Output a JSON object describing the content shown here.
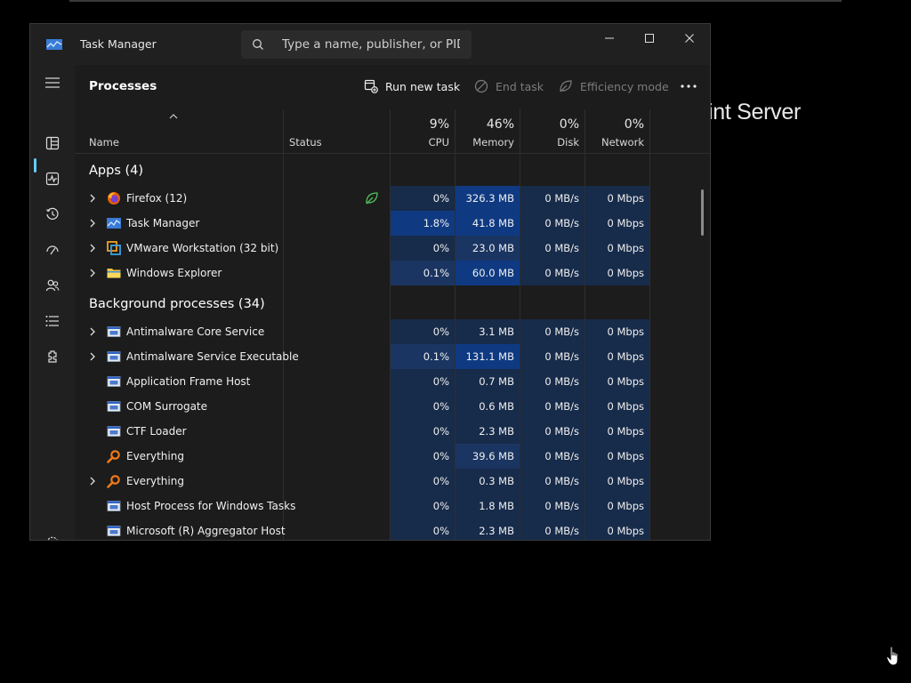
{
  "background": {
    "partial_text": "int Server"
  },
  "window": {
    "title": "Task Manager",
    "search_placeholder": "Type a name, publisher, or PID..."
  },
  "nav": {
    "items": [
      {
        "name": "hamburger-menu-icon"
      },
      {
        "name": "processes-icon",
        "selected": true
      },
      {
        "name": "performance-icon"
      },
      {
        "name": "app-history-icon"
      },
      {
        "name": "startup-apps-icon"
      },
      {
        "name": "users-icon"
      },
      {
        "name": "details-icon"
      },
      {
        "name": "services-icon"
      },
      {
        "name": "settings-icon"
      }
    ]
  },
  "toolbar": {
    "title": "Processes",
    "run_new_task": "Run new task",
    "end_task": "End task",
    "efficiency_mode": "Efficiency mode"
  },
  "columns": {
    "name": "Name",
    "status": "Status",
    "cpu": {
      "pct": "9%",
      "label": "CPU"
    },
    "memory": {
      "pct": "46%",
      "label": "Memory"
    },
    "disk": {
      "pct": "0%",
      "label": "Disk"
    },
    "network": {
      "pct": "0%",
      "label": "Network"
    }
  },
  "groups": {
    "apps": "Apps (4)",
    "background": "Background processes (34)"
  },
  "apps": [
    {
      "name": "Firefox (12)",
      "icon": "firefox-icon",
      "expand": true,
      "status": "efficiency-leaf",
      "cpu": "0%",
      "memory": "326.3 MB",
      "disk": "0 MB/s",
      "network": "0 Mbps"
    },
    {
      "name": "Task Manager",
      "icon": "task-manager-icon",
      "expand": true,
      "cpu": "1.8%",
      "memory": "41.8 MB",
      "disk": "0 MB/s",
      "network": "0 Mbps"
    },
    {
      "name": "VMware Workstation (32 bit)",
      "icon": "vmware-icon",
      "expand": true,
      "cpu": "0%",
      "memory": "23.0 MB",
      "disk": "0 MB/s",
      "network": "0 Mbps"
    },
    {
      "name": "Windows Explorer",
      "icon": "folder-icon",
      "expand": true,
      "cpu": "0.1%",
      "memory": "60.0 MB",
      "disk": "0 MB/s",
      "network": "0 Mbps"
    }
  ],
  "background_processes": [
    {
      "name": "Antimalware Core Service",
      "icon": "service-window-icon",
      "expand": true,
      "cpu": "0%",
      "memory": "3.1 MB",
      "disk": "0 MB/s",
      "network": "0 Mbps"
    },
    {
      "name": "Antimalware Service Executable",
      "icon": "service-window-icon",
      "expand": true,
      "cpu": "0.1%",
      "memory": "131.1 MB",
      "disk": "0 MB/s",
      "network": "0 Mbps"
    },
    {
      "name": "Application Frame Host",
      "icon": "service-window-icon",
      "expand": false,
      "cpu": "0%",
      "memory": "0.7 MB",
      "disk": "0 MB/s",
      "network": "0 Mbps"
    },
    {
      "name": "COM Surrogate",
      "icon": "service-window-icon",
      "expand": false,
      "cpu": "0%",
      "memory": "0.6 MB",
      "disk": "0 MB/s",
      "network": "0 Mbps"
    },
    {
      "name": "CTF Loader",
      "icon": "service-window-icon",
      "expand": false,
      "cpu": "0%",
      "memory": "2.3 MB",
      "disk": "0 MB/s",
      "network": "0 Mbps"
    },
    {
      "name": "Everything",
      "icon": "everything-search-icon",
      "expand": false,
      "cpu": "0%",
      "memory": "39.6 MB",
      "disk": "0 MB/s",
      "network": "0 Mbps"
    },
    {
      "name": "Everything",
      "icon": "everything-search-icon",
      "expand": true,
      "cpu": "0%",
      "memory": "0.3 MB",
      "disk": "0 MB/s",
      "network": "0 Mbps"
    },
    {
      "name": "Host Process for Windows Tasks",
      "icon": "service-window-icon",
      "expand": false,
      "cpu": "0%",
      "memory": "1.8 MB",
      "disk": "0 MB/s",
      "network": "0 Mbps"
    },
    {
      "name": "Microsoft (R) Aggregator Host",
      "icon": "service-window-icon",
      "expand": false,
      "cpu": "0%",
      "memory": "2.3 MB",
      "disk": "0 MB/s",
      "network": "0 Mbps"
    }
  ],
  "colors": {
    "heat_low": "#172b4a",
    "heat_mid": "#1a3561",
    "heat_high": "#0f3a82",
    "accent": "#60cdff"
  }
}
